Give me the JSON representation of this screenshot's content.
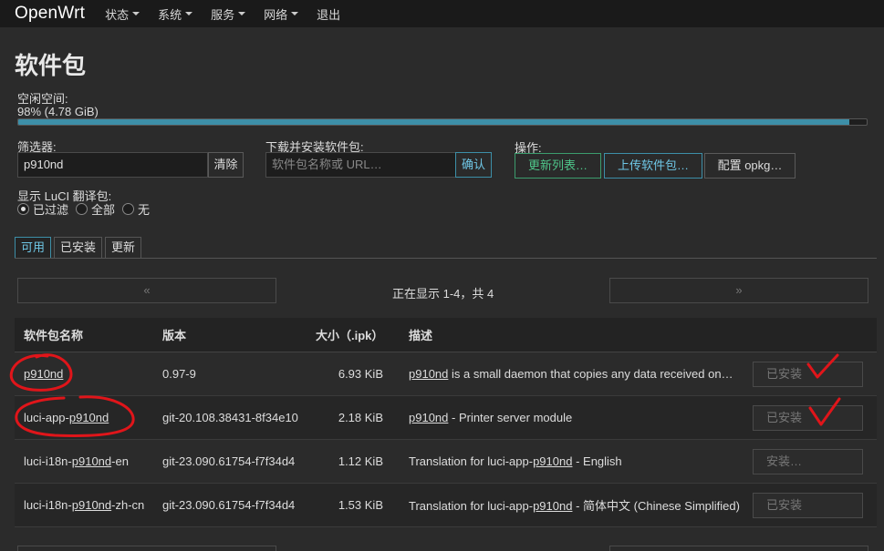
{
  "navbar": {
    "brand": "OpenWrt",
    "items": [
      {
        "label": "状态",
        "has_menu": true
      },
      {
        "label": "系统",
        "has_menu": true
      },
      {
        "label": "服务",
        "has_menu": true
      },
      {
        "label": "网络",
        "has_menu": true
      },
      {
        "label": "退出",
        "has_menu": false
      }
    ]
  },
  "page": {
    "title": "软件包",
    "free_space_label": "空闲空间:",
    "free_space_value": "98% (4.78 GiB)",
    "free_space_percent": 98
  },
  "filter": {
    "label": "筛选器:",
    "value": "p910nd",
    "clear_label": "清除"
  },
  "download": {
    "label": "下载并安装软件包:",
    "placeholder": "软件包名称或 URL…",
    "confirm_label": "确认"
  },
  "actions": {
    "label": "操作:",
    "update_lists": "更新列表…",
    "upload_package": "上传软件包…",
    "configure_opkg": "配置 opkg…"
  },
  "translations": {
    "label": "显示 LuCI 翻译包:",
    "options": [
      {
        "label": "已过滤",
        "checked": true
      },
      {
        "label": "全部",
        "checked": false
      },
      {
        "label": "无",
        "checked": false
      }
    ]
  },
  "tabs": [
    {
      "label": "可用",
      "active": true
    },
    {
      "label": "已安装",
      "active": false
    },
    {
      "label": "更新",
      "active": false
    }
  ],
  "pager": {
    "prev": "«",
    "next": "»",
    "status": "正在显示 1-4，共 4"
  },
  "table": {
    "headers": [
      "软件包名称",
      "版本",
      "大小（.ipk）",
      "描述"
    ],
    "rows": [
      {
        "name_pre": "",
        "name_match": "p910nd",
        "name_post": "",
        "version": "0.97-9",
        "size": "6.93 KiB",
        "desc_pre": "",
        "desc_match": "p910nd",
        "desc_post": " is a small daemon that copies any data received on…",
        "action": "已安装"
      },
      {
        "name_pre": "luci-app-",
        "name_match": "p910nd",
        "name_post": "",
        "version": "git-20.108.38431-8f34e10",
        "size": "2.18 KiB",
        "desc_pre": "",
        "desc_match": "p910nd",
        "desc_post": " - Printer server module",
        "action": "已安装"
      },
      {
        "name_pre": "luci-i18n-",
        "name_match": "p910nd",
        "name_post": "-en",
        "version": "git-23.090.61754-f7f34d4",
        "size": "1.12 KiB",
        "desc_pre": "Translation for luci-app-",
        "desc_match": "p910nd",
        "desc_post": " - English",
        "action": "安装…"
      },
      {
        "name_pre": "luci-i18n-",
        "name_match": "p910nd",
        "name_post": "-zh-cn",
        "version": "git-23.090.61754-f7f34d4",
        "size": "1.53 KiB",
        "desc_pre": "Translation for luci-app-",
        "desc_match": "p910nd",
        "desc_post": " - 简体中文 (Chinese Simplified)",
        "action": "已安装"
      }
    ]
  },
  "colors": {
    "accent": "#3d8fa8",
    "success": "#4fc58a",
    "annotation": "#e0151a"
  }
}
